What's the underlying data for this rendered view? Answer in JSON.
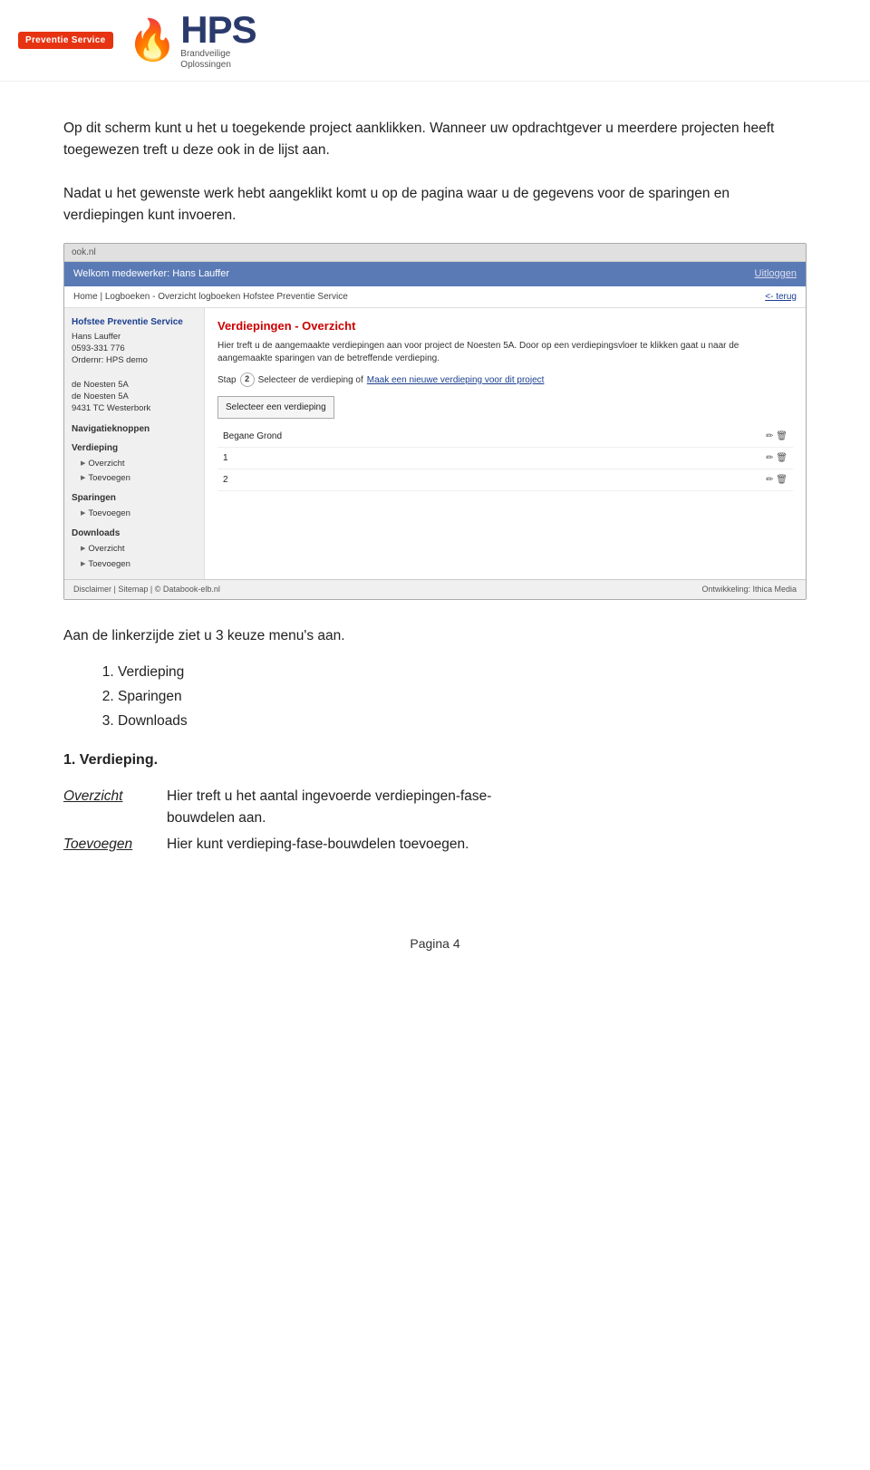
{
  "header": {
    "logo_brand": "Preventie Service",
    "logo_letters": "HPS",
    "logo_sub_line1": "Brandveilige",
    "logo_sub_line2": "Oplossingen"
  },
  "intro": {
    "para1": "Op dit scherm kunt u het u toegekende project aanklikken. Wanneer uw opdrachtgever u meerdere projecten heeft toegewezen treft u deze ook in de lijst aan.",
    "para2": "Nadat u het gewenste werk hebt aangeklikt komt u op de pagina waar u de gegevens voor de sparingen en verdiepingen kunt invoeren."
  },
  "screenshot": {
    "topbar_text": "Welkom medewerker: Hans Lauffer",
    "topbar_logout": "Uitloggen",
    "back_link": "<- terug",
    "breadcrumb": "Home | Logboeken - Overzicht logboeken Hofstee Preventie Service",
    "url_bar": "ook.nl",
    "sidebar": {
      "company_name": "Hofstee Preventie Service",
      "person": "Hans Lauffer",
      "phone": "0593-331 776",
      "order": "Ordernr: HPS demo",
      "address1": "de Noesten 5A",
      "address2": "de Noesten 5A",
      "postcode": "9431 TC Westerbork",
      "nav_header": "Navigatieknoppen",
      "sections": [
        {
          "title": "Verdieping",
          "items": [
            "Overzicht",
            "Toevoegen"
          ]
        },
        {
          "title": "Sparingen",
          "items": [
            "Toevoegen"
          ]
        },
        {
          "title": "Downloads",
          "items": [
            "Overzicht",
            "Toevoegen"
          ]
        }
      ]
    },
    "main": {
      "heading": "Verdiepingen - Overzicht",
      "desc": "Hier treft u de aangemaakte verdiepingen aan voor project de Noesten 5A. Door op een verdiepingsvloer te klikken gaat u naar de aangemaakte sparingen van de betreffende verdieping.",
      "stap_label": "Stap",
      "stap_number": "2",
      "stap_text": "Selecteer de verdieping of",
      "stap_link": "Maak een nieuwe verdieping voor dit project",
      "select_box_label": "Selecteer een verdieping",
      "rows": [
        {
          "name": "Begane Grond"
        },
        {
          "name": "1"
        },
        {
          "name": "2"
        }
      ]
    },
    "footer_left": "Disclaimer | Sitemap | © Databook-elb.nl",
    "footer_right": "Ontwikkeling: Ithica Media"
  },
  "menu_intro": "Aan de linkerzijde ziet u 3 keuze menu's aan.",
  "menu_items": [
    "Verdieping",
    "Sparingen",
    "Downloads"
  ],
  "section1_heading": "1.  Verdieping.",
  "detail_rows": [
    {
      "label": "Overzicht",
      "desc": "Hier treft u het aantal ingevoerde verdiepingen-fase-\nbouwdelen aan."
    },
    {
      "label": "Toevoegen",
      "desc": "Hier kunt verdieping-fase-bouwdelen toevoegen."
    }
  ],
  "page_number": "Pagina 4"
}
